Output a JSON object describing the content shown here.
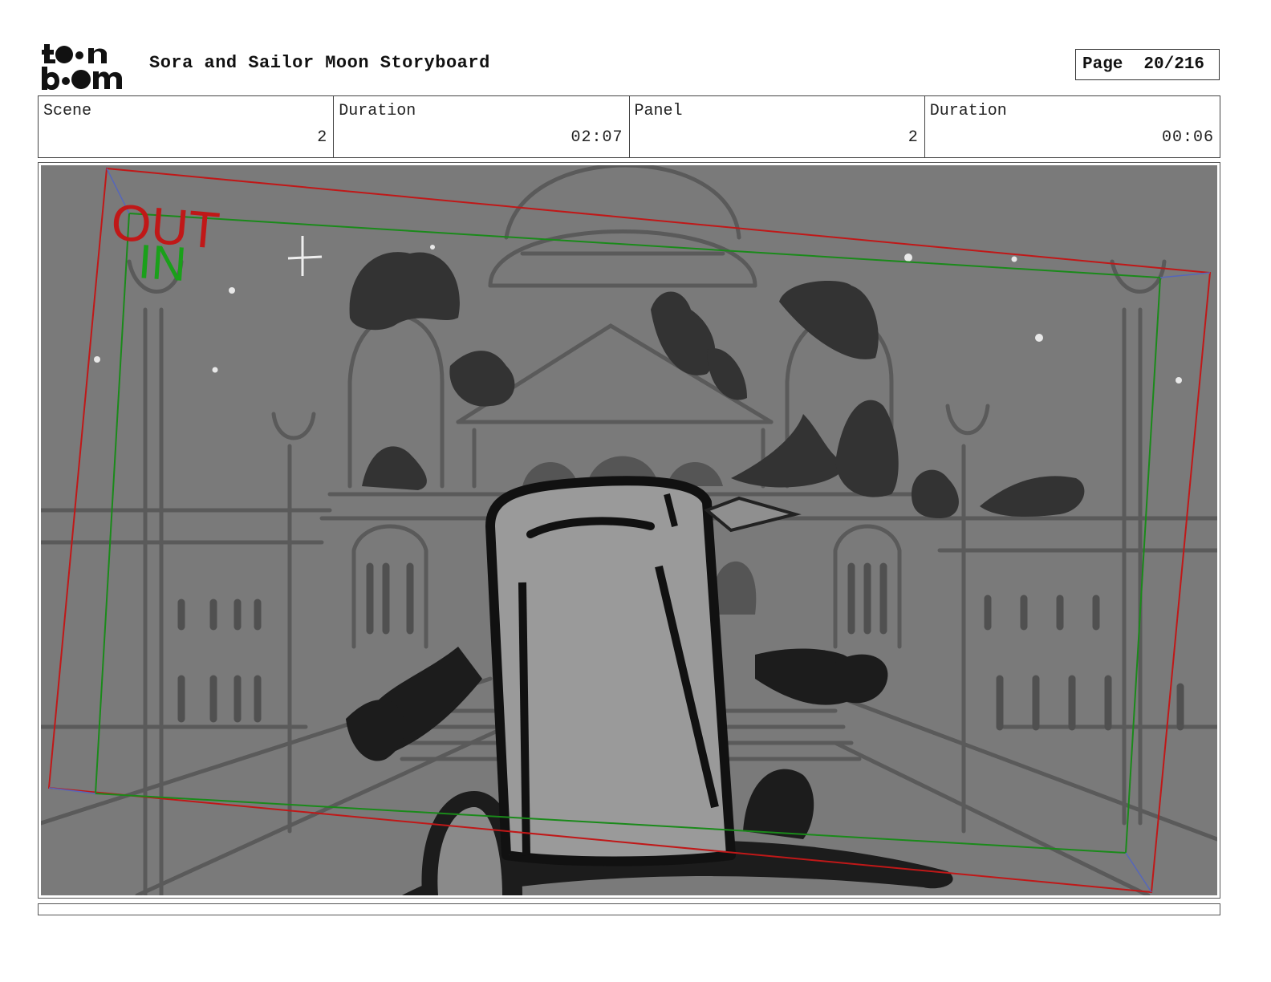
{
  "header": {
    "logo_text": "toon boom",
    "title": "Sora and Sailor Moon Storyboard",
    "page_label": "Page",
    "page_value": "20/216"
  },
  "info": {
    "scene_label": "Scene",
    "scene_value": "2",
    "scene_duration_label": "Duration",
    "scene_duration_value": "02:07",
    "panel_label": "Panel",
    "panel_value": "2",
    "panel_duration_label": "Duration",
    "panel_duration_value": "00:06"
  },
  "panel": {
    "camera_out_label": "OUT",
    "camera_in_label": "IN",
    "colors": {
      "out_frame": "#c01818",
      "in_frame": "#1a8a1a",
      "background": "#7a7a7a"
    }
  }
}
